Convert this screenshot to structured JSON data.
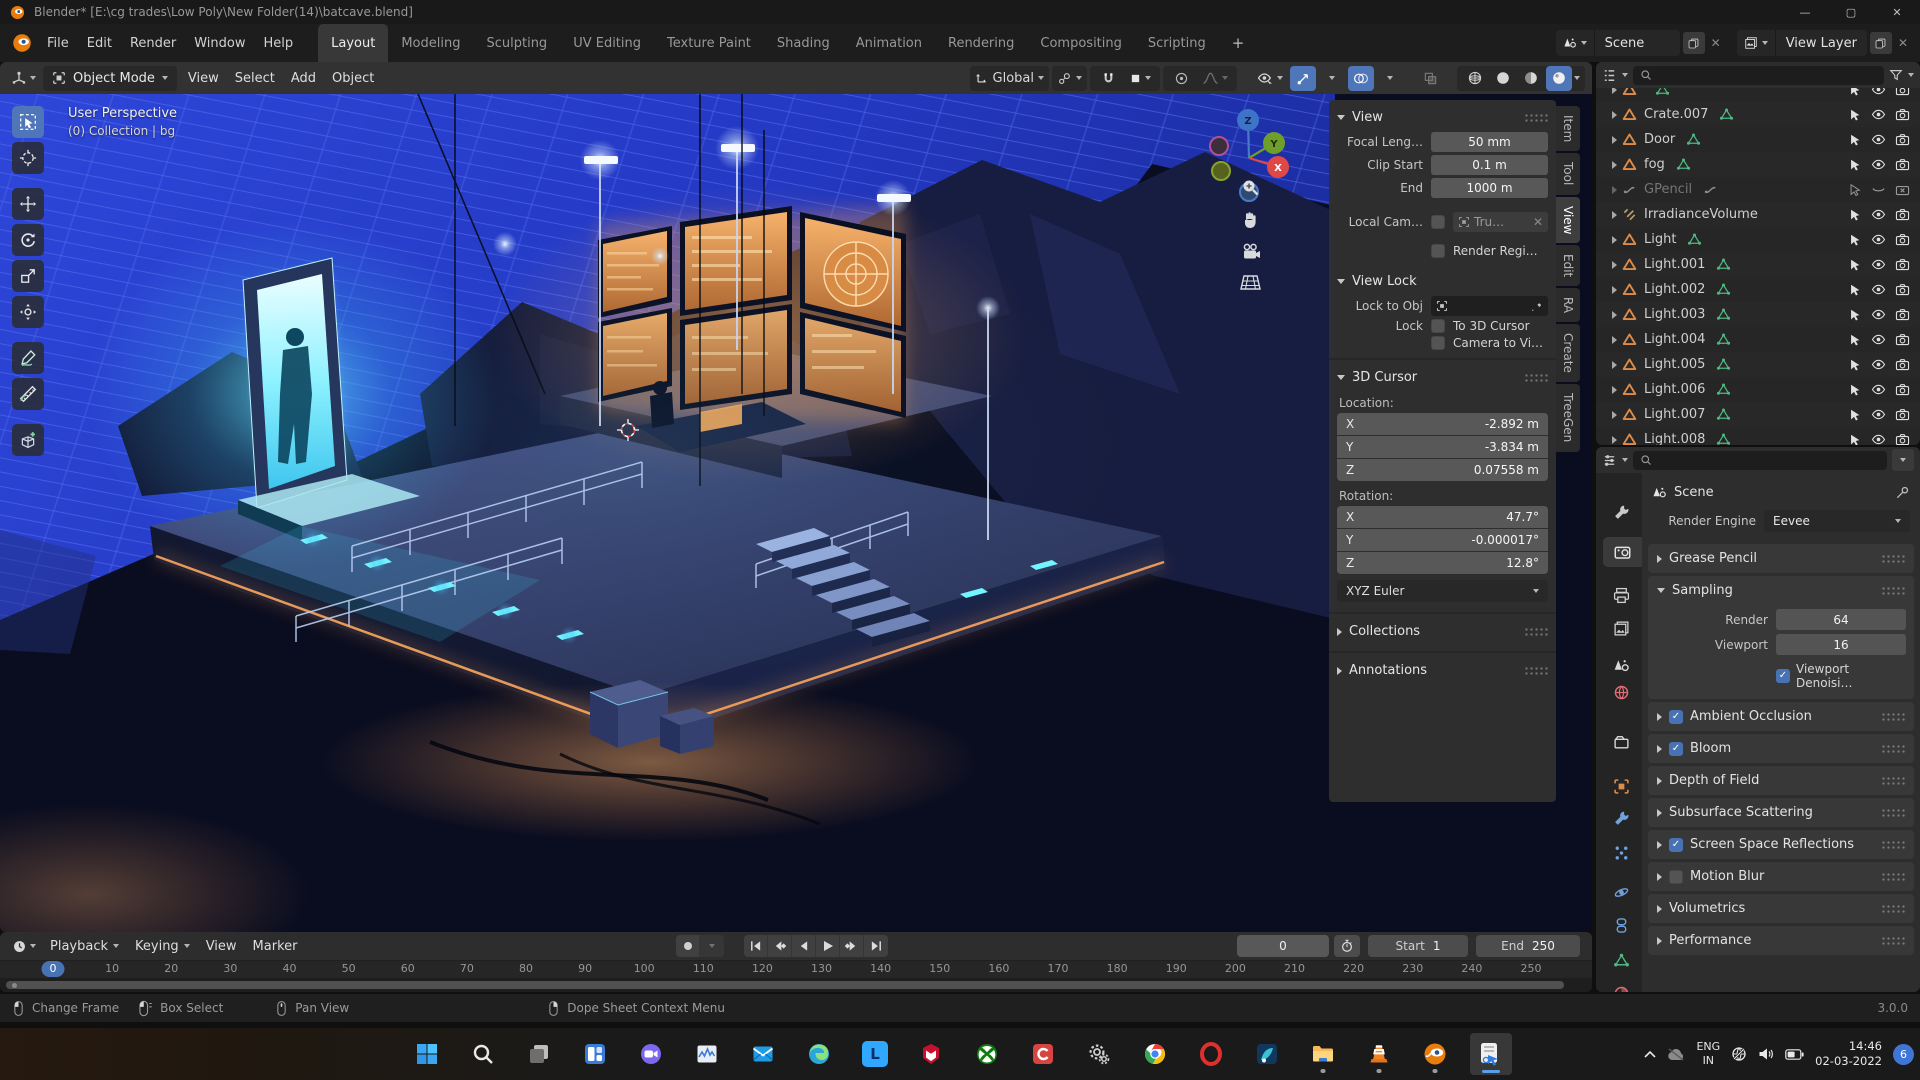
{
  "window": {
    "title": "Blender* [E:\\cg trades\\Low Poly\\New Folder(14)\\batcave.blend]",
    "controls": [
      "minimize",
      "maximize",
      "close"
    ]
  },
  "topbar": {
    "menus": [
      "File",
      "Edit",
      "Render",
      "Window",
      "Help"
    ],
    "workspaces": [
      {
        "label": "Layout",
        "active": true
      },
      {
        "label": "Modeling"
      },
      {
        "label": "Sculpting"
      },
      {
        "label": "UV Editing"
      },
      {
        "label": "Texture Paint"
      },
      {
        "label": "Shading"
      },
      {
        "label": "Animation"
      },
      {
        "label": "Rendering"
      },
      {
        "label": "Compositing"
      },
      {
        "label": "Scripting"
      }
    ],
    "add_workspace_label": "+",
    "scene_label": "Scene",
    "view_layer_label": "View Layer"
  },
  "viewport": {
    "header": {
      "mode": "Object Mode",
      "menus": [
        "View",
        "Select",
        "Add",
        "Object"
      ],
      "orientation": "Global"
    },
    "overlay": {
      "line1": "User Perspective",
      "line2": "(0) Collection | bg"
    },
    "gizmo_axes": {
      "x": "X",
      "y": "Y",
      "z": "Z"
    },
    "toolbar": [
      {
        "tool": "select-box",
        "active": true
      },
      {
        "tool": "cursor"
      },
      {
        "tool": "move",
        "group": true
      },
      {
        "tool": "rotate"
      },
      {
        "tool": "scale"
      },
      {
        "tool": "transform"
      },
      {
        "tool": "annotate",
        "group": true
      },
      {
        "tool": "measure"
      },
      {
        "tool": "add-cube",
        "group": true
      }
    ]
  },
  "sidebar": {
    "tabs": [
      {
        "label": "Item"
      },
      {
        "label": "Tool"
      },
      {
        "label": "View",
        "active": true
      },
      {
        "label": "Edit"
      },
      {
        "label": "RA"
      },
      {
        "label": "Create"
      },
      {
        "label": "TreeGen"
      }
    ],
    "view_panel": {
      "title": "View",
      "fields": [
        {
          "label": "Focal Leng…",
          "value": "50 mm"
        },
        {
          "label": "Clip Start",
          "value": "0.1 m"
        },
        {
          "label": "End",
          "value": "1000 m"
        }
      ],
      "local_camera_label": "Local Cam…",
      "local_camera_value": "Tru…",
      "render_region_label": "Render Regi…",
      "view_lock_title": "View Lock",
      "lock_to_obj_label": "Lock to Obj",
      "lock_label": "Lock",
      "to_3d_cursor_label": "To 3D Cursor",
      "camera_to_view_label": "Camera to Vi…"
    },
    "cursor_panel": {
      "title": "3D Cursor",
      "location_label": "Location:",
      "location": [
        {
          "axis": "X",
          "value": "-2.892 m"
        },
        {
          "axis": "Y",
          "value": "-3.834 m"
        },
        {
          "axis": "Z",
          "value": "0.07558 m"
        }
      ],
      "rotation_label": "Rotation:",
      "rotation": [
        {
          "axis": "X",
          "value": "47.7°"
        },
        {
          "axis": "Y",
          "value": "-0.000017°"
        },
        {
          "axis": "Z",
          "value": "12.8°"
        }
      ],
      "rotation_mode": "XYZ Euler"
    },
    "collections_label": "Collections",
    "annotations_label": "Annotations"
  },
  "outliner": {
    "rows": [
      {
        "name": "",
        "icon": "mesh",
        "data_icon": "meshdata",
        "clipped_top": true
      },
      {
        "name": "Crate.007",
        "icon": "mesh",
        "data_icon": "meshdata"
      },
      {
        "name": "Door",
        "icon": "mesh",
        "data_icon": "meshdata"
      },
      {
        "name": "fog",
        "icon": "mesh",
        "data_icon": "meshdata"
      },
      {
        "name": "GPencil",
        "icon": "gpencil",
        "data_icon": "gpencil",
        "muted": true
      },
      {
        "name": "IrradianceVolume",
        "icon": "probe",
        "data_icon": ""
      },
      {
        "name": "Light",
        "icon": "mesh",
        "data_icon": "meshdata"
      },
      {
        "name": "Light.001",
        "icon": "mesh",
        "data_icon": "meshdata"
      },
      {
        "name": "Light.002",
        "icon": "mesh",
        "data_icon": "meshdata"
      },
      {
        "name": "Light.003",
        "icon": "mesh",
        "data_icon": "meshdata"
      },
      {
        "name": "Light.004",
        "icon": "mesh",
        "data_icon": "meshdata"
      },
      {
        "name": "Light.005",
        "icon": "mesh",
        "data_icon": "meshdata"
      },
      {
        "name": "Light.006",
        "icon": "mesh",
        "data_icon": "meshdata"
      },
      {
        "name": "Light.007",
        "icon": "mesh",
        "data_icon": "meshdata"
      },
      {
        "name": "Light.008",
        "icon": "mesh",
        "data_icon": "meshdata"
      }
    ]
  },
  "properties": {
    "breadcrumb": "Scene",
    "render_engine_label": "Render Engine",
    "render_engine": "Eevee",
    "tabs": [
      {
        "id": "tool"
      },
      {
        "id": "render",
        "active": true
      },
      {
        "id": "output"
      },
      {
        "id": "view-layer"
      },
      {
        "id": "scene"
      },
      {
        "id": "world"
      },
      {
        "id": "collection"
      },
      {
        "id": "object"
      },
      {
        "id": "modifiers"
      },
      {
        "id": "particles"
      },
      {
        "id": "physics"
      },
      {
        "id": "constraints"
      },
      {
        "id": "data"
      },
      {
        "id": "material"
      }
    ],
    "sections": [
      {
        "label": "Grease Pencil"
      },
      {
        "label": "Sampling",
        "expanded": true,
        "rows": [
          {
            "label": "Render",
            "value": "64"
          },
          {
            "label": "Viewport",
            "value": "16"
          }
        ],
        "checkbox_label": "Viewport Denoisi…",
        "checkbox_checked": true
      },
      {
        "label": "Ambient Occlusion",
        "checkbox": true,
        "checked": true
      },
      {
        "label": "Bloom",
        "checkbox": true,
        "checked": true
      },
      {
        "label": "Depth of Field"
      },
      {
        "label": "Subsurface Scattering"
      },
      {
        "label": "Screen Space Reflections",
        "checkbox": true,
        "checked": true
      },
      {
        "label": "Motion Blur",
        "checkbox": true,
        "checked": false
      },
      {
        "label": "Volumetrics"
      },
      {
        "label": "Performance"
      }
    ]
  },
  "timeline": {
    "menus": [
      "Playback",
      "Keying",
      "View",
      "Marker"
    ],
    "current_frame": "0",
    "start_label": "Start",
    "start_value": "1",
    "end_label": "End",
    "end_value": "250",
    "ticks": [
      0,
      10,
      20,
      30,
      40,
      50,
      60,
      70,
      80,
      90,
      100,
      110,
      120,
      130,
      140,
      150,
      160,
      170,
      180,
      190,
      200,
      210,
      220,
      230,
      240,
      250
    ]
  },
  "statusbar": {
    "hints": [
      {
        "button": "mouse-left",
        "label": "Change Frame"
      },
      {
        "button": "mouse-left-drag",
        "label": "Box Select"
      },
      {
        "button": "mouse-middle",
        "label": "Pan View"
      },
      {
        "button": "mouse-right",
        "label": "Dope Sheet Context Menu"
      }
    ],
    "version": "3.0.0"
  },
  "taskbar": {
    "icons": [
      {
        "id": "start"
      },
      {
        "id": "search"
      },
      {
        "id": "task-view"
      },
      {
        "id": "widgets"
      },
      {
        "id": "zoom"
      },
      {
        "id": "task-manager"
      },
      {
        "id": "mail"
      },
      {
        "id": "edge"
      },
      {
        "id": "lightroom"
      },
      {
        "id": "mcafee"
      },
      {
        "id": "xbox"
      },
      {
        "id": "camtasia"
      },
      {
        "id": "settings"
      },
      {
        "id": "chrome"
      },
      {
        "id": "opera"
      },
      {
        "id": "filmora"
      },
      {
        "id": "explorer",
        "running": true
      },
      {
        "id": "vlc",
        "running": true
      },
      {
        "id": "blender",
        "running": true
      },
      {
        "id": "capture",
        "active": true
      }
    ],
    "tray": {
      "language": "ENG",
      "region": "IN",
      "time": "14:46",
      "date": "02-03-2022",
      "badge": "6"
    }
  },
  "colors": {
    "accent": "#4772b3",
    "active_tool": "#4f76b8",
    "portal_cyan": "#8ef2ff",
    "screen_orange": "#f0a05c"
  }
}
